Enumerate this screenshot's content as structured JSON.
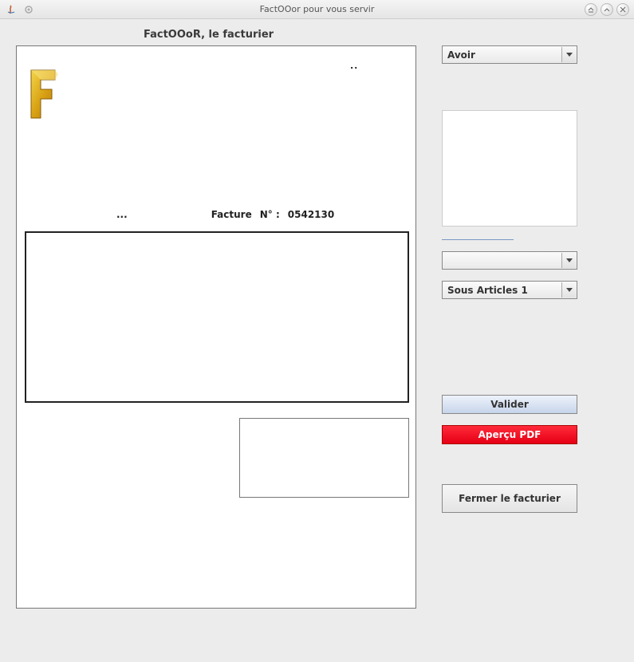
{
  "window": {
    "title": "FactOOor pour vous servir"
  },
  "app": {
    "subtitle": "FactOOoR, le facturier"
  },
  "document": {
    "header_dots": "..",
    "client_dots": "...",
    "facture_label": "Facture",
    "numero_label": "N° :",
    "numero_value": "0542130"
  },
  "controls": {
    "type_select": "Avoir",
    "category_select": "",
    "subarticle_select": "Sous Articles 1",
    "valider_label": "Valider",
    "apercu_pdf_label": "Aperçu PDF",
    "fermer_label": "Fermer le facturier"
  }
}
